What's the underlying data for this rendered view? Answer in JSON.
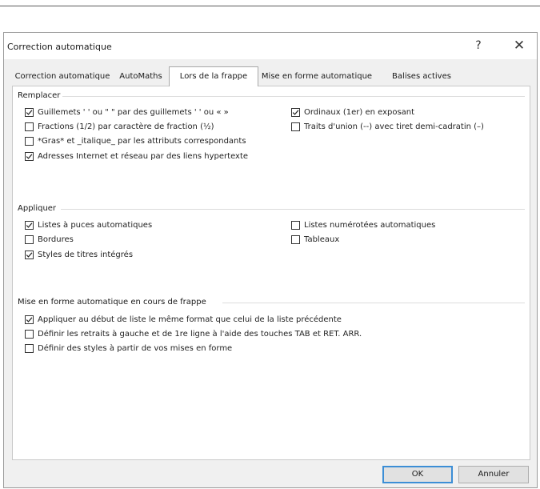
{
  "dialog": {
    "title": "Correction automatique",
    "help_label": "?",
    "close_label": "✕"
  },
  "tabs": [
    {
      "label": "Correction automatique",
      "active": false
    },
    {
      "label": "AutoMaths",
      "active": false
    },
    {
      "label": "Lors de la frappe",
      "active": true
    },
    {
      "label": "Mise en forme automatique",
      "active": false
    },
    {
      "label": "Balises actives",
      "active": false
    }
  ],
  "groups": {
    "replace": {
      "title": "Remplacer",
      "options": [
        {
          "label": "Guillemets ' ' ou \" \" par des guillemets ' ' ou « »",
          "checked": true
        },
        {
          "label": "Fractions (1/2) par caractère de fraction (½)",
          "checked": false
        },
        {
          "label": "*Gras* et _italique_ par les attributs correspondants",
          "checked": false
        },
        {
          "label": "Adresses Internet et réseau par des liens hypertexte",
          "checked": true
        },
        {
          "label": "Ordinaux (1er) en exposant",
          "checked": true
        },
        {
          "label": "Traits d'union (--) avec tiret demi-cadratin (–)",
          "checked": false
        }
      ]
    },
    "apply": {
      "title": "Appliquer",
      "options": [
        {
          "label": "Listes à puces automatiques",
          "checked": true
        },
        {
          "label": "Bordures",
          "checked": false
        },
        {
          "label": "Styles de titres intégrés",
          "checked": true
        },
        {
          "label": "Listes numérotées automatiques",
          "checked": false
        },
        {
          "label": "Tableaux",
          "checked": false
        }
      ]
    },
    "format": {
      "title": "Mise en forme automatique en cours de frappe",
      "options": [
        {
          "label": "Appliquer au début de liste le même format que celui de la liste précédente",
          "checked": true
        },
        {
          "label": "Définir les retraits à gauche et de 1re ligne à l'aide des touches TAB et RET. ARR.",
          "checked": false
        },
        {
          "label": "Définir des styles à partir de vos mises en forme",
          "checked": false
        }
      ]
    }
  },
  "buttons": {
    "ok": "OK",
    "cancel": "Annuler"
  }
}
